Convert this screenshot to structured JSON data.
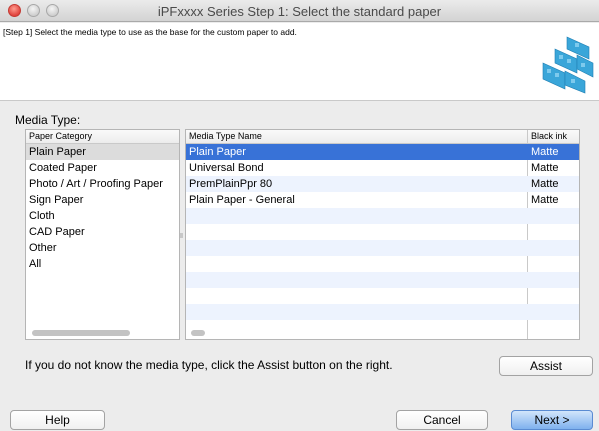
{
  "window": {
    "title": "iPFxxxx Series Step 1: Select the standard paper"
  },
  "header": {
    "step_text": "[Step 1] Select the media type to use as the base for the custom paper to add."
  },
  "media": {
    "label": "Media Type:",
    "category_header": "Paper Category",
    "categories": [
      "Plain Paper",
      "Coated Paper",
      "Photo / Art / Proofing Paper",
      "Sign Paper",
      "Cloth",
      "CAD Paper",
      "Other",
      "All"
    ],
    "selected_category": "Plain Paper",
    "table_headers": [
      "Media Type Name",
      "Black ink"
    ],
    "rows": [
      {
        "name": "Plain Paper",
        "ink": "Matte"
      },
      {
        "name": "Universal Bond",
        "ink": "Matte"
      },
      {
        "name": "PremPlainPpr 80",
        "ink": "Matte"
      },
      {
        "name": "Plain Paper - General",
        "ink": "Matte"
      }
    ],
    "selected_row": "Plain Paper"
  },
  "hint": "If you do not know the media type, click the Assist button on the right.",
  "buttons": {
    "assist": "Assist",
    "help": "Help",
    "cancel": "Cancel",
    "next": "Next >"
  },
  "colors": {
    "selection": "#3872d7",
    "default_button": "#7fb1ee",
    "logo": "#3aa6d9"
  }
}
